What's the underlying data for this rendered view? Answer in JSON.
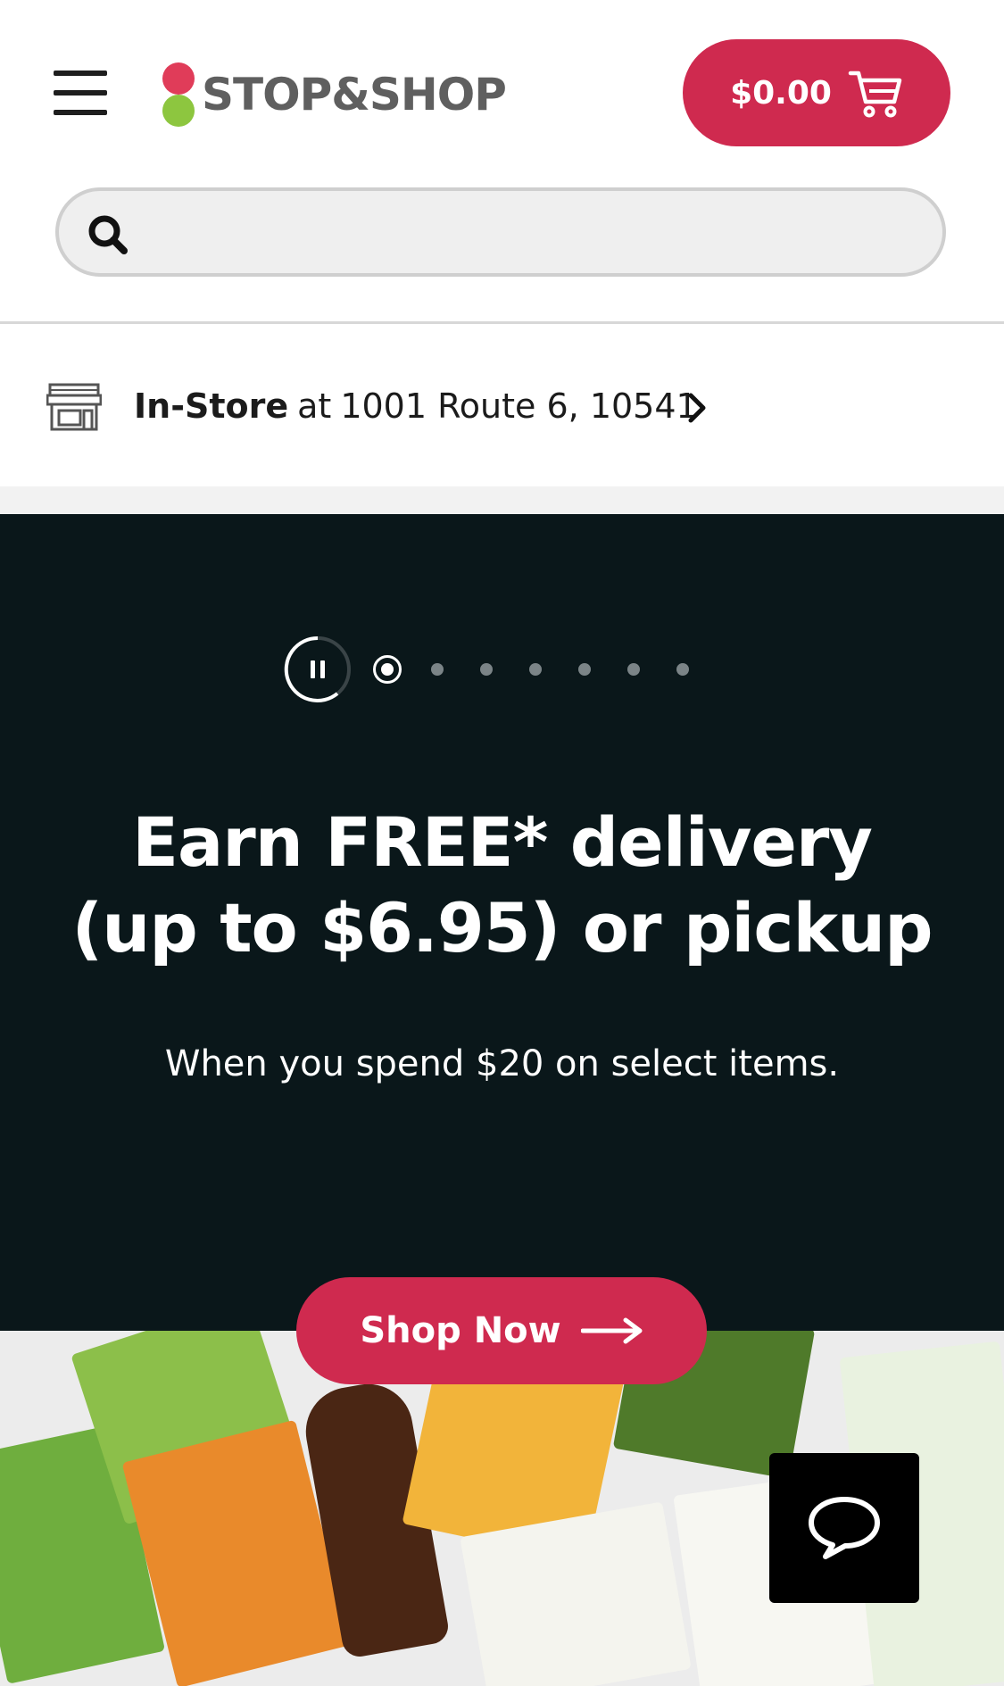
{
  "header": {
    "logo_text": "STOP&SHOP",
    "cart_total": "$0.00"
  },
  "search": {
    "placeholder": ""
  },
  "store": {
    "mode": "In-Store",
    "at": "at",
    "address": "1001 Route 6, 10541"
  },
  "hero": {
    "headline_line1": "Earn FREE* delivery",
    "headline_line2": "(up to $6.95) or pickup",
    "subline": "When you spend $20 on select items.",
    "cta_label": "Shop Now",
    "slide_count": 7,
    "active_slide": 1
  },
  "colors": {
    "brand_red": "#cf2a4f",
    "logo_red": "#e03c59",
    "logo_green": "#8dc63f",
    "hero_bg": "#0a171a"
  },
  "icons": [
    "hamburger-menu-icon",
    "cart-icon",
    "search-icon",
    "store-icon",
    "chevron-right-icon",
    "pause-icon",
    "arrow-right-icon",
    "chat-icon"
  ]
}
